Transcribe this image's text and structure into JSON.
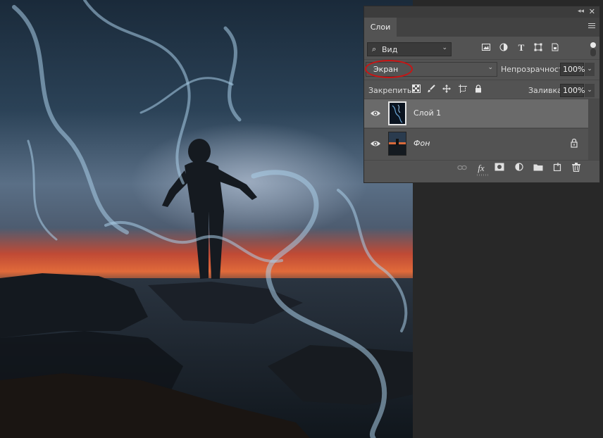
{
  "panel": {
    "tab_label": "Слои",
    "filter": {
      "label": "Вид",
      "icon": "search-icon"
    },
    "filter_icons": [
      "image-filter-icon",
      "adjustment-filter-icon",
      "type-filter-icon",
      "shape-filter-icon",
      "smart-object-filter-icon"
    ],
    "blend_mode": "Экран",
    "opacity_label": "Непрозрачность:",
    "opacity_value": "100%",
    "lock_label": "Закрепить:",
    "lock_icons": [
      "lock-transparent-pixels-icon",
      "lock-image-pixels-icon",
      "lock-position-icon",
      "prevent-autonest-icon",
      "lock-all-icon"
    ],
    "fill_label": "Заливка:",
    "fill_value": "100%",
    "layers": [
      {
        "name": "Слой 1",
        "visible": true,
        "selected": true,
        "locked": false,
        "italic": false
      },
      {
        "name": "Фон",
        "visible": true,
        "selected": false,
        "locked": true,
        "italic": true
      }
    ],
    "footer_icons": [
      "link-layers-icon",
      "fx-icon",
      "add-mask-icon",
      "adjustment-layer-icon",
      "new-group-icon",
      "new-layer-icon",
      "delete-layer-icon"
    ],
    "highlight_color": "#c81414"
  }
}
